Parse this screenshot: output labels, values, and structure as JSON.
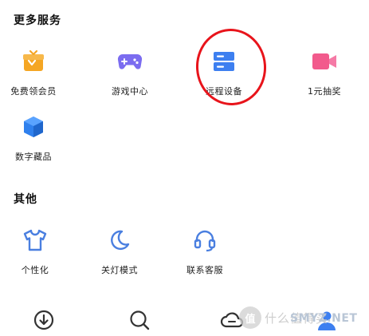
{
  "sections": {
    "more_services": {
      "title": "更多服务",
      "items": [
        {
          "label": "免费领会员",
          "icon": "gift-box-icon",
          "color": "#f5a623"
        },
        {
          "label": "游戏中心",
          "icon": "gamepad-icon",
          "color": "#7b6cf0"
        },
        {
          "label": "远程设备",
          "icon": "server-icon",
          "color": "#3d7ff0"
        },
        {
          "label": "1元抽奖",
          "icon": "video-camera-icon",
          "color": "#f25a8c"
        },
        {
          "label": "数字藏品",
          "icon": "cube-icon",
          "color": "#2f80ed"
        }
      ]
    },
    "other": {
      "title": "其他",
      "items": [
        {
          "label": "个性化",
          "icon": "tshirt-icon",
          "color": "#4a7fe0"
        },
        {
          "label": "关灯模式",
          "icon": "moon-icon",
          "color": "#4a7fe0"
        },
        {
          "label": "联系客服",
          "icon": "headset-icon",
          "color": "#4a7fe0"
        }
      ]
    }
  },
  "tabbar": {
    "items": [
      {
        "icon": "download-icon"
      },
      {
        "icon": "search-icon"
      },
      {
        "icon": "cloud-icon"
      },
      {
        "icon": "user-icon"
      }
    ]
  },
  "annotation": {
    "color": "#e8141b"
  },
  "watermark": {
    "text": "什么值得买",
    "logo_char": "值",
    "brand": "SMYZ.NET"
  }
}
